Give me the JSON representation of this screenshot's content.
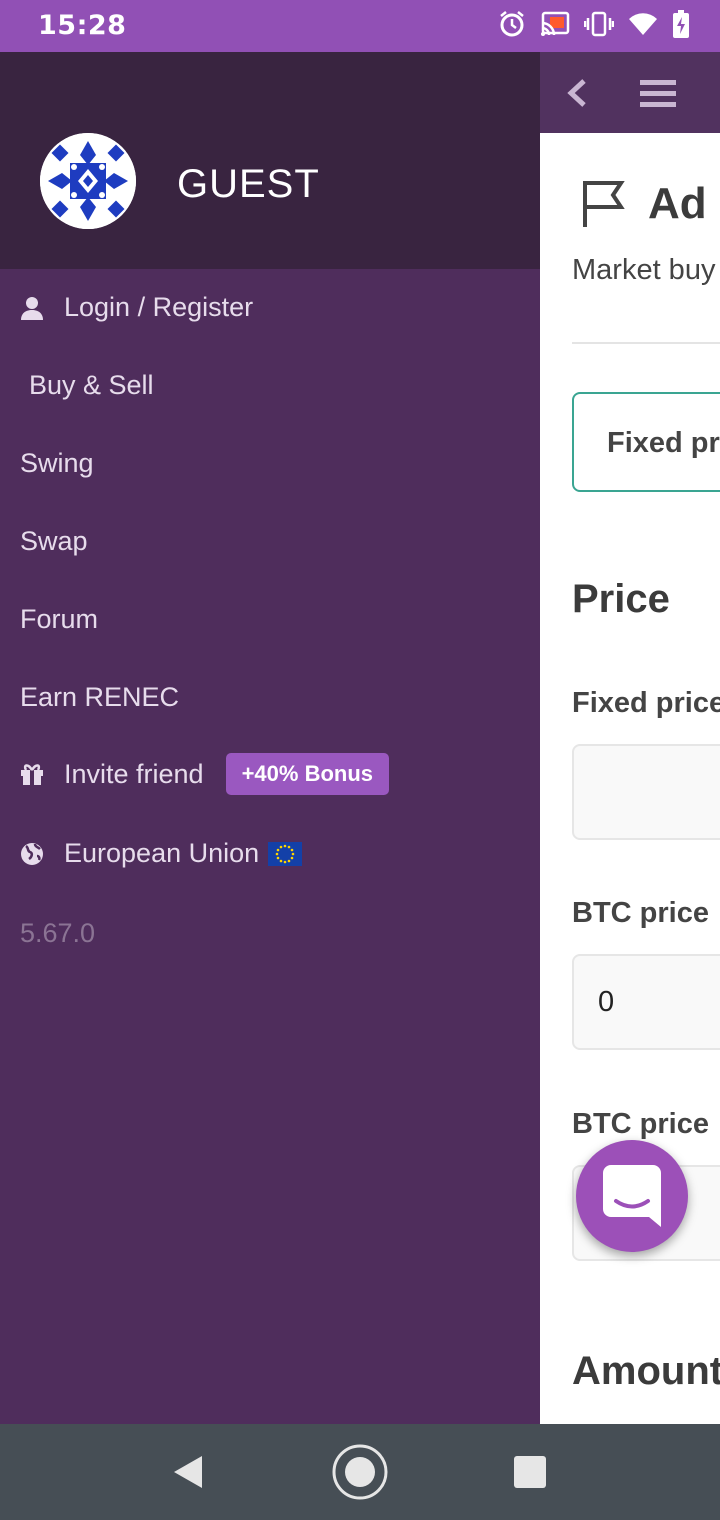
{
  "status_bar": {
    "time": "15:28",
    "icons": [
      "alarm-icon",
      "cast-icon",
      "vibrate-icon",
      "wifi-icon",
      "battery-charging-icon"
    ]
  },
  "drawer": {
    "user_name": "GUEST",
    "items": [
      {
        "label": "Login / Register",
        "icon": "user-icon"
      },
      {
        "label": "Buy & Sell"
      },
      {
        "label": "Swing"
      },
      {
        "label": "Swap"
      },
      {
        "label": "Forum"
      },
      {
        "label": "Earn RENEC"
      },
      {
        "label": "Invite friend",
        "icon": "gift-icon",
        "badge": "+40% Bonus"
      },
      {
        "label": "European Union",
        "icon": "globe-icon",
        "flag": "eu-flag"
      }
    ],
    "version": "5.67.0"
  },
  "main": {
    "title": "Ad",
    "subtitle": "Market buy",
    "price_type_option": "Fixed pr",
    "price_heading": "Price",
    "fixed_price_label": "Fixed price",
    "btc_price_label_1": "BTC price",
    "btc_price_value": "0",
    "btc_price_label_2": "BTC price",
    "amount_heading": "Amount"
  },
  "colors": {
    "status_bar": "#9150b5",
    "drawer_bg": "#4f2d5c",
    "drawer_header": "#392440",
    "badge": "#9a58c0",
    "fab": "#9c50b8",
    "accent_border": "#3aa592"
  }
}
